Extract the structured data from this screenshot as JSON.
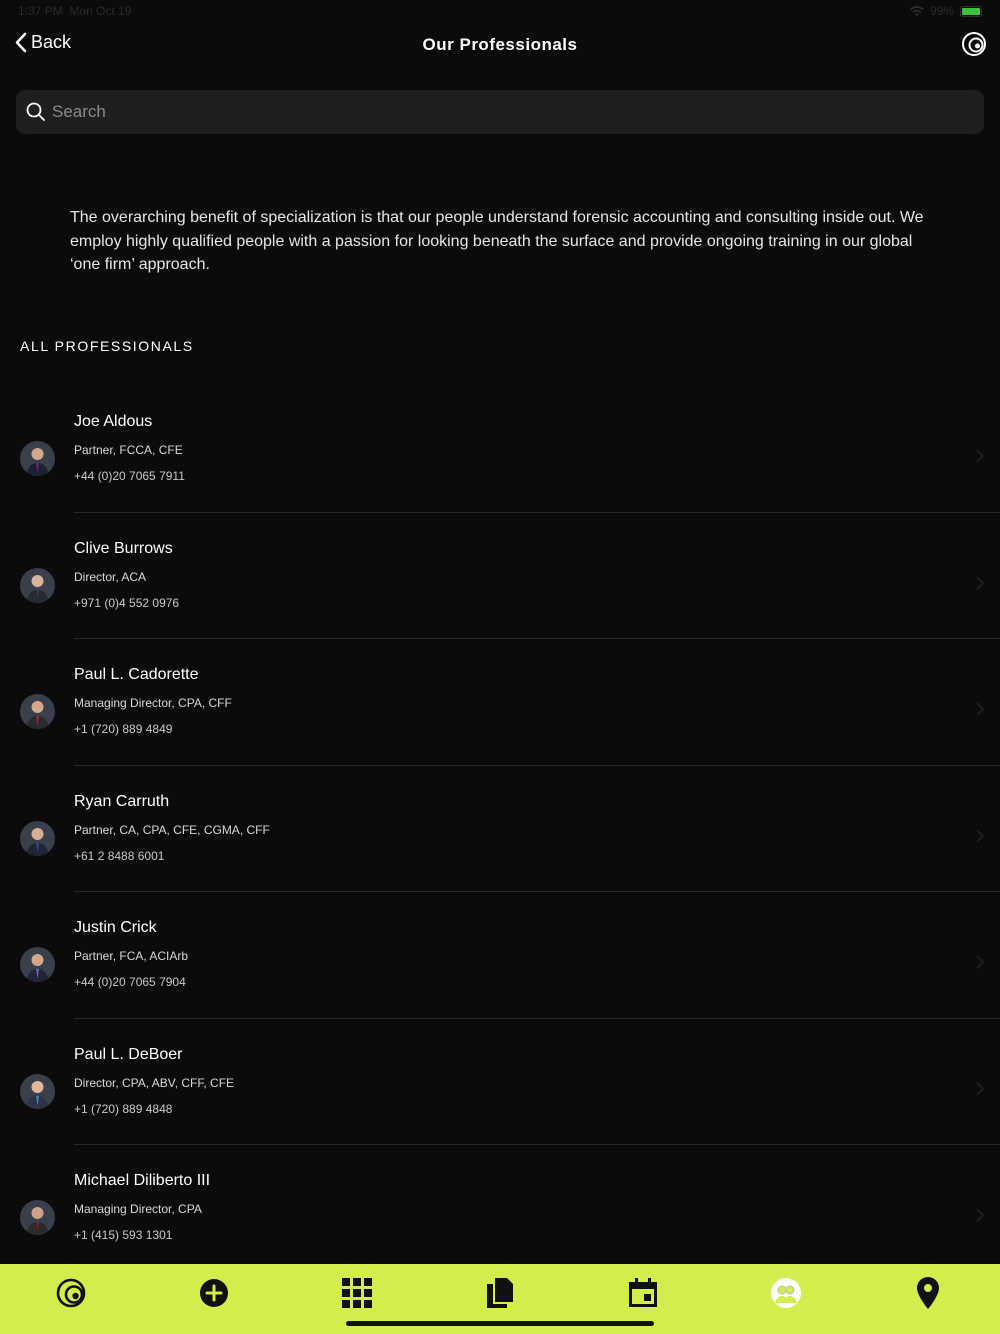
{
  "status_bar": {
    "time": "1:37 PM",
    "date": "Mon Oct 19",
    "battery": "99%"
  },
  "nav": {
    "back_label": "Back",
    "title": "Our Professionals"
  },
  "search": {
    "placeholder": "Search"
  },
  "intro": "The overarching benefit of specialization is that our people understand forensic accounting and consulting inside out. We employ highly qualified people with a passion for looking beneath the surface and provide ongoing training in our global ‘one firm’ approach.",
  "section_header": "ALL PROFESSIONALS",
  "professionals": [
    {
      "name": "Joe Aldous",
      "title": "Partner, FCCA, CFE",
      "phone": "+44 (0)20 7065 7911"
    },
    {
      "name": "Clive Burrows",
      "title": "Director, ACA",
      "phone": "+971 (0)4 552 0976"
    },
    {
      "name": "Paul L. Cadorette",
      "title": "Managing Director, CPA, CFF",
      "phone": "+1 (720) 889 4849"
    },
    {
      "name": "Ryan Carruth",
      "title": "Partner, CA, CPA, CFE, CGMA, CFF",
      "phone": "+61 2 8488 6001"
    },
    {
      "name": "Justin Crick",
      "title": "Partner, FCA, ACIArb",
      "phone": "+44 (0)20 7065 7904"
    },
    {
      "name": "Paul L. DeBoer",
      "title": "Director, CPA, ABV, CFF, CFE",
      "phone": "+1 (720) 889 4848"
    },
    {
      "name": "Michael Diliberto III",
      "title": "Managing Director, CPA",
      "phone": "+1 (415) 593 1301"
    }
  ],
  "tab_bar": {
    "accent": "#d4ec4c",
    "tabs": [
      "logo-icon",
      "plus-circle-icon",
      "grid-icon",
      "documents-icon",
      "calendar-icon",
      "people-icon",
      "location-pin-icon"
    ]
  }
}
